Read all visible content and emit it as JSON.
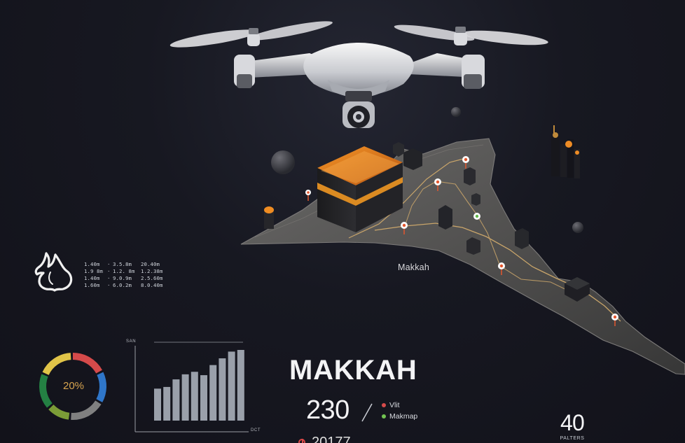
{
  "map": {
    "label": "Makkah",
    "terrain_color": "#555453",
    "route_color": "#c9a56a",
    "marker_color": "#e4572e",
    "active_marker_color": "#62b84a"
  },
  "stats": {
    "rows": [
      [
        "1.40m",
        "·",
        "3.5.8m",
        "20.40m"
      ],
      [
        "1.9 8m",
        "·",
        "1.2. 8m",
        "1.2.38m"
      ],
      [
        "1.40m",
        "·",
        "9.0.9m",
        "2.5.60m"
      ],
      [
        "1.60m",
        "·",
        "6.0.2m",
        "8.0.40m"
      ]
    ]
  },
  "donut": {
    "label": "20%",
    "value_percent": 20,
    "segments": [
      {
        "color": "#d54a4a",
        "share": 18
      },
      {
        "color": "#2f76c9",
        "share": 16
      },
      {
        "color": "#808080",
        "share": 18
      },
      {
        "color": "#7b9d37",
        "share": 12
      },
      {
        "color": "#248043",
        "share": 18
      },
      {
        "color": "#e1c448",
        "share": 18
      }
    ]
  },
  "bar_chart": {
    "top_label": "SAN",
    "bottom_label": "DCT",
    "values": [
      38,
      40,
      49,
      55,
      58,
      54,
      66,
      74,
      82,
      84
    ]
  },
  "headline": {
    "title": "MAKKAH",
    "primary_value": "230",
    "separator": "/",
    "legend_items": [
      {
        "label": "Vlit",
        "color": "#d64b4b"
      },
      {
        "label": "Makmap",
        "color": "#72c452"
      }
    ],
    "secondary_value": "40",
    "secondary_caption": "PALTERS",
    "bottom_readout": "20177"
  },
  "colors": {
    "background": "#161620",
    "accent": "#f18d20",
    "white": "#f3f3f5"
  },
  "icons": {
    "drone": "drone-icon",
    "kaaba": "kaaba-icon",
    "hand": "hand-icon",
    "timer": "timer-icon"
  }
}
